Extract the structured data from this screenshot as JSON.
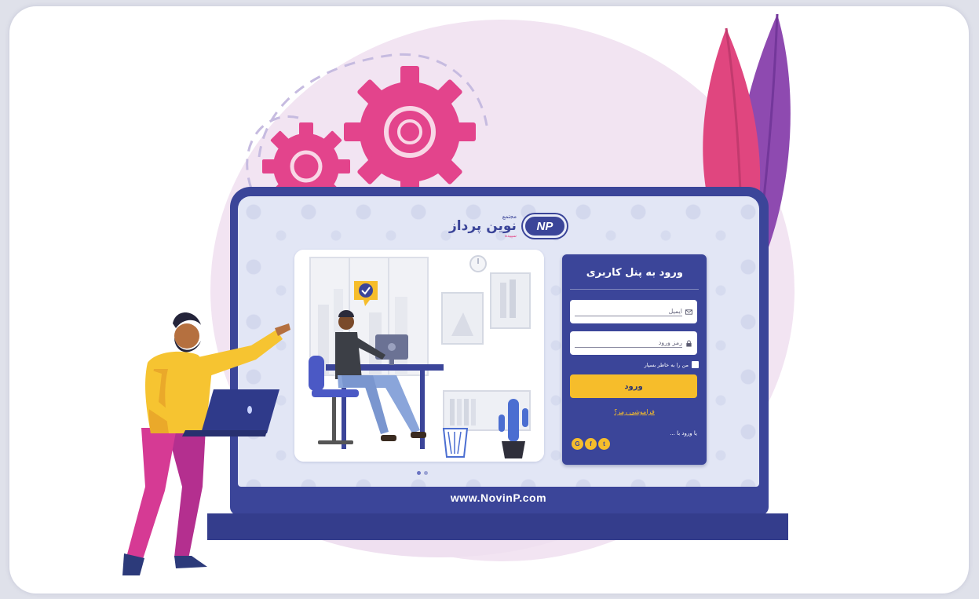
{
  "logo": {
    "small_text": "مجتمع",
    "name": "نوین پرداز",
    "sub_text": "سپیده",
    "badge": "NP"
  },
  "login": {
    "title": "ورود به پنل کاربری",
    "email_placeholder": "ایمیل",
    "password_placeholder": "رمز ورود",
    "remember_label": "من را به خاطر بسپار",
    "submit_label": "ورود",
    "forgot_label": "فراموشی رمز؟",
    "login_with_label": "یا ورود با ..."
  },
  "socials": {
    "google": "G",
    "facebook": "f",
    "twitter": "t"
  },
  "footer": {
    "url": "www.NovinP.com"
  },
  "colors": {
    "primary": "#3b4599",
    "accent_yellow": "#f6bd2b",
    "accent_pink": "#e33b7e",
    "screen_bg": "#e2e6f5"
  },
  "icons": [
    "gear-icon",
    "leaf-icon",
    "check-badge-icon",
    "clock-icon",
    "cactus-icon",
    "mail-icon",
    "lock-icon",
    "google-icon",
    "facebook-icon",
    "twitter-icon"
  ]
}
